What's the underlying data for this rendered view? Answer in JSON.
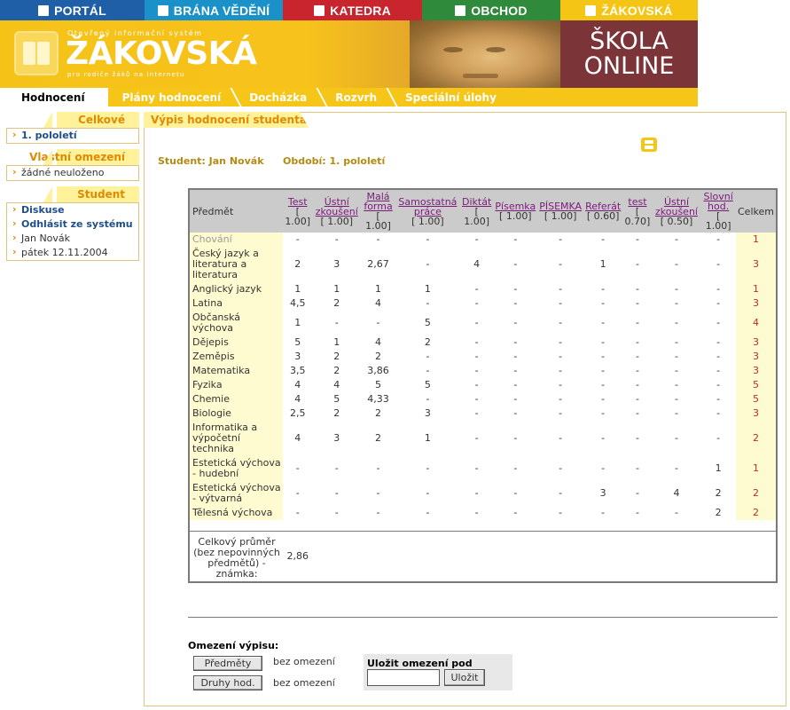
{
  "topnav": [
    {
      "label": "PORTÁL",
      "icon": "portal-icon"
    },
    {
      "label": "BRÁNA VĚDĚNÍ",
      "icon": "brana-icon"
    },
    {
      "label": "KATEDRA",
      "icon": "katedra-icon"
    },
    {
      "label": "OBCHOD",
      "icon": "obchod-icon"
    },
    {
      "label": "ŽÁKOVSKÁ",
      "icon": "zakovska-icon"
    }
  ],
  "banner": {
    "subtitle_top": "Otevřený informační systém",
    "brand": "ŽÁKOVSKÁ",
    "subtitle_bottom": "pro rodiče žáků na internetu",
    "right_line1": "ŠKOLA",
    "right_line2": "ONLINE"
  },
  "tabs": [
    "Hodnocení",
    "Plány hodnocení",
    "Docházka",
    "Rozvrh",
    "Speciální úlohy"
  ],
  "sidebar": {
    "celkove": {
      "title": "Celkové",
      "items": [
        "1. pololetí"
      ]
    },
    "omezeni": {
      "title": "Vlastní omezení",
      "items": [
        "žádné neuloženo"
      ]
    },
    "student": {
      "title": "Student",
      "items": [
        "Diskuse",
        "Odhlásit ze systému",
        "Jan Novák",
        "pátek 12.11.2004"
      ]
    }
  },
  "panel": {
    "title": "Výpis hodnocení studenta",
    "student": "Student: Jan Novák",
    "obdobi": "Období: 1. pololetí"
  },
  "table": {
    "subject_header": "Předmět",
    "total_header": "Celkem",
    "columns": [
      {
        "name": "Test",
        "weight": "[ 1.00]"
      },
      {
        "name": "Ústní zkoušení",
        "weight": "[ 1.00]"
      },
      {
        "name": "Malá forma",
        "weight": "[ 1.00]"
      },
      {
        "name": "Samostatná práce",
        "weight": "[ 1.00]"
      },
      {
        "name": "Diktát",
        "weight": "[ 1.00]"
      },
      {
        "name": "Písemka",
        "weight": "[ 1.00]"
      },
      {
        "name": "PÍSEMKA",
        "weight": "[ 1.00]"
      },
      {
        "name": "Referát",
        "weight": "[ 0.60]"
      },
      {
        "name": "test",
        "weight": "[ 0.70]"
      },
      {
        "name": "Ústní zkoušení",
        "weight": "[ 0.50]"
      },
      {
        "name": "Slovní hod.",
        "weight": "[ 1.00]"
      }
    ],
    "rows": [
      {
        "subject": "Chování",
        "muted": true,
        "grades": [
          "-",
          "-",
          "-",
          "-",
          "-",
          "-",
          "-",
          "-",
          "-",
          "-",
          "-"
        ],
        "total": "1"
      },
      {
        "subject": "Český jazyk a literatura a literatura",
        "grades": [
          "2",
          "3",
          "2,67",
          "-",
          "4",
          "-",
          "-",
          "1",
          "-",
          "-",
          "-"
        ],
        "total": "3"
      },
      {
        "subject": "Anglický jazyk",
        "grades": [
          "1",
          "1",
          "1",
          "1",
          "-",
          "-",
          "-",
          "-",
          "-",
          "-",
          "-"
        ],
        "total": "1"
      },
      {
        "subject": "Latina",
        "grades": [
          "4,5",
          "2",
          "4",
          "-",
          "-",
          "-",
          "-",
          "-",
          "-",
          "-",
          "-"
        ],
        "total": "3"
      },
      {
        "subject": "Občanská výchova",
        "grades": [
          "1",
          "-",
          "-",
          "5",
          "-",
          "-",
          "-",
          "-",
          "-",
          "-",
          "-"
        ],
        "total": "4"
      },
      {
        "subject": "Dějepis",
        "grades": [
          "5",
          "1",
          "4",
          "2",
          "-",
          "-",
          "-",
          "-",
          "-",
          "-",
          "-"
        ],
        "total": "3"
      },
      {
        "subject": "Zeměpis",
        "grades": [
          "3",
          "2",
          "2",
          "-",
          "-",
          "-",
          "-",
          "-",
          "-",
          "-",
          "-"
        ],
        "total": "3"
      },
      {
        "subject": "Matematika",
        "grades": [
          "3,5",
          "2",
          "3,86",
          "-",
          "-",
          "-",
          "-",
          "-",
          "-",
          "-",
          "-"
        ],
        "total": "3"
      },
      {
        "subject": "Fyzika",
        "grades": [
          "4",
          "4",
          "5",
          "5",
          "-",
          "-",
          "-",
          "-",
          "-",
          "-",
          "-"
        ],
        "total": "5"
      },
      {
        "subject": "Chemie",
        "grades": [
          "4",
          "5",
          "4,33",
          "-",
          "-",
          "-",
          "-",
          "-",
          "-",
          "-",
          "-"
        ],
        "total": "5"
      },
      {
        "subject": "Biologie",
        "grades": [
          "2,5",
          "2",
          "2",
          "3",
          "-",
          "-",
          "-",
          "-",
          "-",
          "-",
          "-"
        ],
        "total": "3"
      },
      {
        "subject": "Informatika a výpočetní technika",
        "grades": [
          "4",
          "3",
          "2",
          "1",
          "-",
          "-",
          "-",
          "-",
          "-",
          "-",
          "-"
        ],
        "total": "2"
      },
      {
        "subject": "Estetická výchova - hudební",
        "grades": [
          "-",
          "-",
          "-",
          "-",
          "-",
          "-",
          "-",
          "-",
          "-",
          "-",
          "1"
        ],
        "total": "1"
      },
      {
        "subject": "Estetická výchova - výtvarná",
        "grades": [
          "-",
          "-",
          "-",
          "-",
          "-",
          "-",
          "-",
          "3",
          "-",
          "4",
          "2"
        ],
        "total": "2"
      },
      {
        "subject": "Tělesná výchova",
        "grades": [
          "-",
          "-",
          "-",
          "-",
          "-",
          "-",
          "-",
          "-",
          "-",
          "-",
          "2"
        ],
        "total": "2"
      }
    ],
    "average_label": "Celkový průměr (bez nepovinných předmětů) - známka:",
    "average_value": "2,86"
  },
  "limits": {
    "title": "Omezení výpisu:",
    "subjects_button": "Předměty",
    "subjects_value": "bez omezení",
    "types_button": "Druhy hod.",
    "types_value": "bez omezení",
    "save_label": "Uložit omezení pod názvem:",
    "save_input_value": "",
    "save_button": "Uložit"
  },
  "colors": {
    "accent_yellow": "#f5c518",
    "total_red": "#c0282a",
    "link_purple": "#7b1a7b"
  }
}
